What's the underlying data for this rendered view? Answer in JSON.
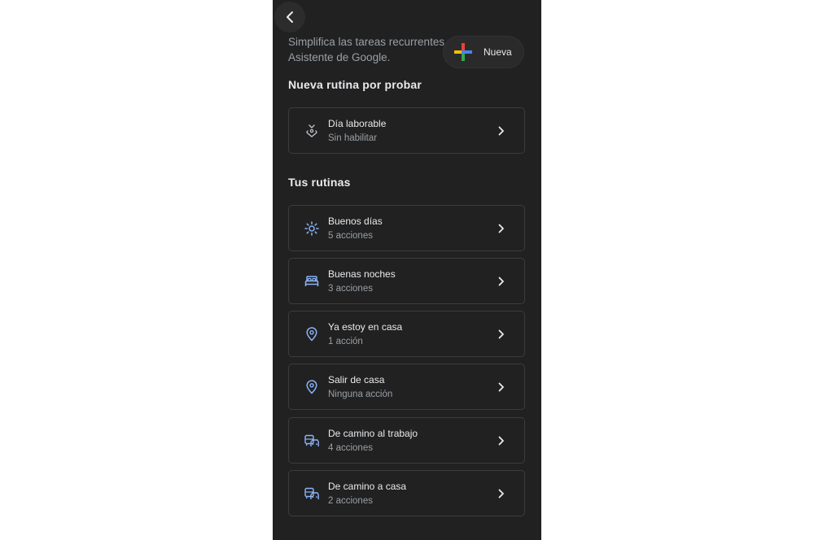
{
  "header": {
    "subtitle_line1": "Simplifica las tareas recurrentes co",
    "subtitle_line2": "Asistente de Google.",
    "new_button_label": "Nueva"
  },
  "suggested": {
    "section_title": "Nueva rutina por probar",
    "items": [
      {
        "title": "Día laborable",
        "subtitle": "Sin habilitar",
        "icon": "workday-icon"
      }
    ]
  },
  "routines": {
    "section_title": "Tus rutinas",
    "items": [
      {
        "title": "Buenos días",
        "subtitle": "5 acciones",
        "icon": "sun-icon"
      },
      {
        "title": "Buenas noches",
        "subtitle": "3 acciones",
        "icon": "bed-icon"
      },
      {
        "title": "Ya estoy en casa",
        "subtitle": "1 acción",
        "icon": "location-pin-icon"
      },
      {
        "title": "Salir de casa",
        "subtitle": "Ninguna acción",
        "icon": "location-pin-icon"
      },
      {
        "title": "De camino al trabajo",
        "subtitle": "4 acciones",
        "icon": "commute-icon"
      },
      {
        "title": "De camino a casa",
        "subtitle": "2 acciones",
        "icon": "commute-icon"
      }
    ]
  },
  "colors": {
    "background": "#212121",
    "card_border": "#3c3c3c",
    "text_primary": "#e8eaed",
    "text_secondary": "#9aa0a6",
    "icon_blue": "#8ab4f8",
    "google_red": "#ea4335",
    "google_blue": "#4285f4",
    "google_yellow": "#fbbc04",
    "google_green": "#34a853"
  }
}
